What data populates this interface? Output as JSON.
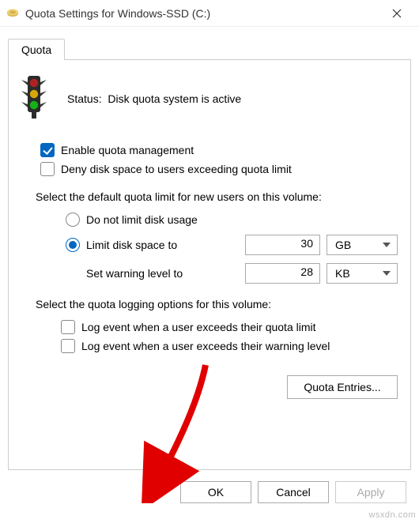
{
  "window": {
    "title": "Quota Settings for Windows-SSD (C:)"
  },
  "tab": {
    "label": "Quota"
  },
  "status": {
    "label": "Status:",
    "value": "Disk quota system is active"
  },
  "options": {
    "enable_quota": {
      "label": "Enable quota management",
      "checked": true
    },
    "deny_space": {
      "label": "Deny disk space to users exceeding quota limit",
      "checked": false
    }
  },
  "default_limit_heading": "Select the default quota limit for new users on this volume:",
  "limit": {
    "no_limit": {
      "label": "Do not limit disk usage",
      "selected": false
    },
    "limit_to": {
      "label": "Limit disk space to",
      "selected": true,
      "value": "30",
      "unit": "GB"
    },
    "warning": {
      "label": "Set warning level to",
      "value": "28",
      "unit": "KB"
    }
  },
  "logging_heading": "Select the quota logging options for this volume:",
  "logging": {
    "exceed_limit": {
      "label": "Log event when a user exceeds their quota limit",
      "checked": false
    },
    "exceed_warning": {
      "label": "Log event when a user exceeds their warning level",
      "checked": false
    }
  },
  "buttons": {
    "entries": "Quota Entries...",
    "ok": "OK",
    "cancel": "Cancel",
    "apply": "Apply"
  },
  "watermark": "wsxdn.com"
}
